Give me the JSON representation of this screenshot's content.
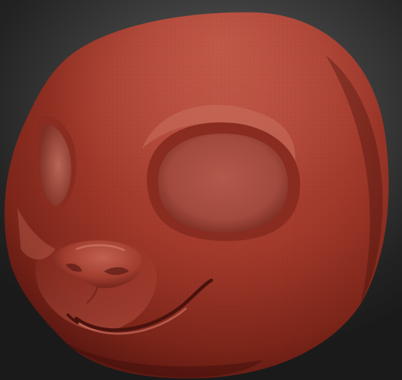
{
  "scene": {
    "background_color": "#2a2a2a",
    "material_color": "#a83a2c",
    "highlight_color": "#e08a7a",
    "shadow_color": "#4a120d"
  }
}
